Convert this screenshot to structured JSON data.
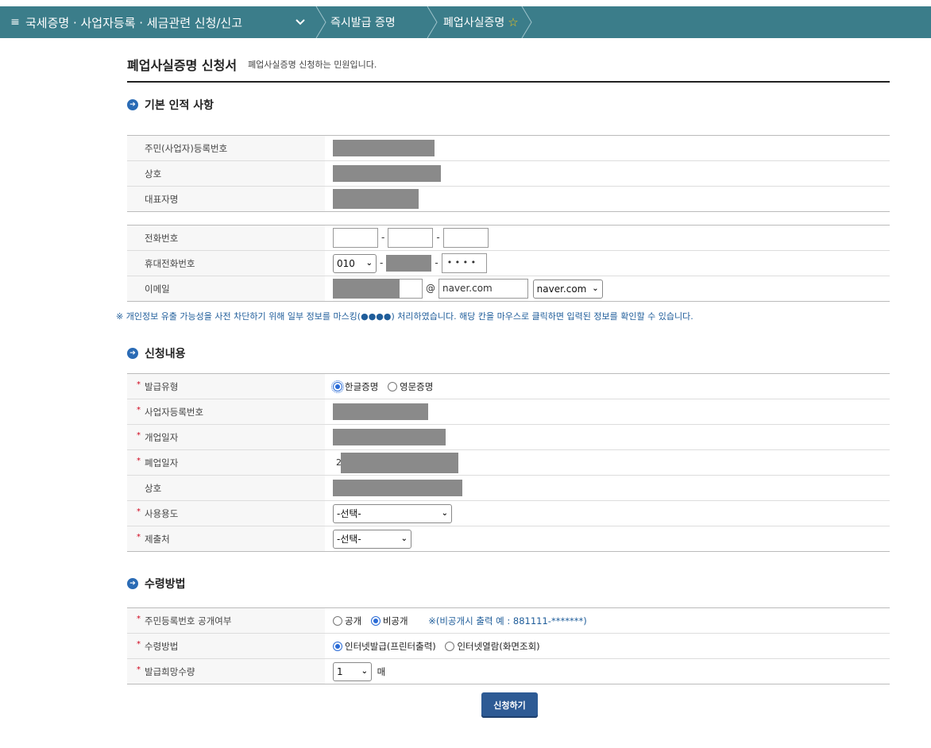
{
  "nav": {
    "menu_icon": "≡",
    "crumb1": "국세증명 · 사업자등록 · 세금관련 신청/신고",
    "crumb2": "즉시발급 증명",
    "crumb3": "폐업사실증명",
    "star_icon": "☆"
  },
  "page": {
    "title": "폐업사실증명 신청서",
    "subtitle": "폐업사실증명 신청하는 민원입니다."
  },
  "basic": {
    "section_title": "기본 인적 사항",
    "labels": {
      "resident_no": "주민(사업자)등록번호",
      "company": "상호",
      "ceo": "대표자명",
      "phone": "전화번호",
      "mobile": "휴대전화번호",
      "email": "이메일"
    },
    "mobile_prefix": "010",
    "mobile_last": "• • • •",
    "email_at": "@",
    "email_domain": "naver.com",
    "email_domain_select": "naver.com",
    "dash": "-"
  },
  "notice": "※ 개인정보 유출 가능성을 사전 차단하기 위해 일부 정보를 마스킹(●●●●) 처리하였습니다. 해당 칸을 마우스로 클릭하면 입력된 정보를 확인할 수 있습니다.",
  "apply": {
    "section_title": "신청내용",
    "labels": {
      "issue_type": "발급유형",
      "biz_no": "사업자등록번호",
      "open_date": "개업일자",
      "close_date": "폐업일자",
      "company": "상호",
      "purpose": "사용용도",
      "submit_to": "제출처"
    },
    "issue_korean": "한글증명",
    "issue_english": "영문증명",
    "close_date_prefix": "2",
    "purpose_select": "-선택-",
    "submit_select": "-선택-"
  },
  "receive": {
    "section_title": "수령방법",
    "labels": {
      "disclose": "주민등록번호 공개여부",
      "method": "수령방법",
      "quantity": "발급희망수량"
    },
    "public": "공개",
    "private": "비공개",
    "private_hint": "※(비공개시 출력 예 : 881111-*******)",
    "method_internet": "인터넷발급(프린터출력)",
    "method_view": "인터넷열람(화면조회)",
    "quantity_value": "1",
    "quantity_unit": "매"
  },
  "submit_label": "신청하기",
  "colors": {
    "nav_bg": "#3b7d8a",
    "button_bg": "#2d5a94",
    "accent": "#2a6bb5",
    "required": "#d0021b"
  }
}
